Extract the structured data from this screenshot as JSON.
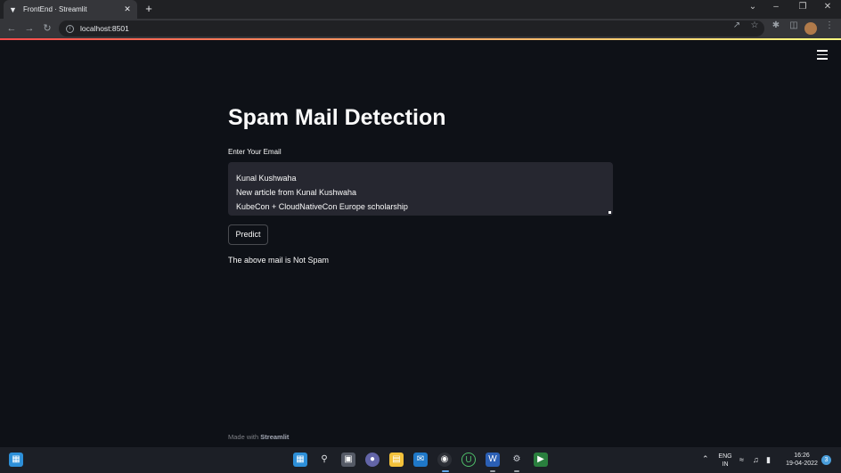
{
  "browser": {
    "tab_title": "FrontEnd · Streamlit",
    "url": "localhost:8501",
    "new_tab_icon": "plus-icon",
    "close_tab_icon": "close-icon"
  },
  "app": {
    "title": "Spam Mail Detection",
    "input_label": "Enter Your Email",
    "input_value_lines": [
      "Kunal Kushwaha",
      "New article from Kunal Kushwaha",
      "KubeCon + CloudNativeCon Europe scholarship"
    ],
    "predict_label": "Predict",
    "result_text": "The above mail is Not Spam",
    "footer_prefix": "Made with",
    "footer_brand": "Streamlit"
  },
  "taskbar": {
    "lang_line1": "ENG",
    "lang_line2": "IN",
    "time": "16:26",
    "date": "19-04-2022",
    "notification_count": "3"
  },
  "colors": {
    "background": "#0e1117",
    "input_bg": "#262730",
    "accent": "#ff4b4b"
  }
}
